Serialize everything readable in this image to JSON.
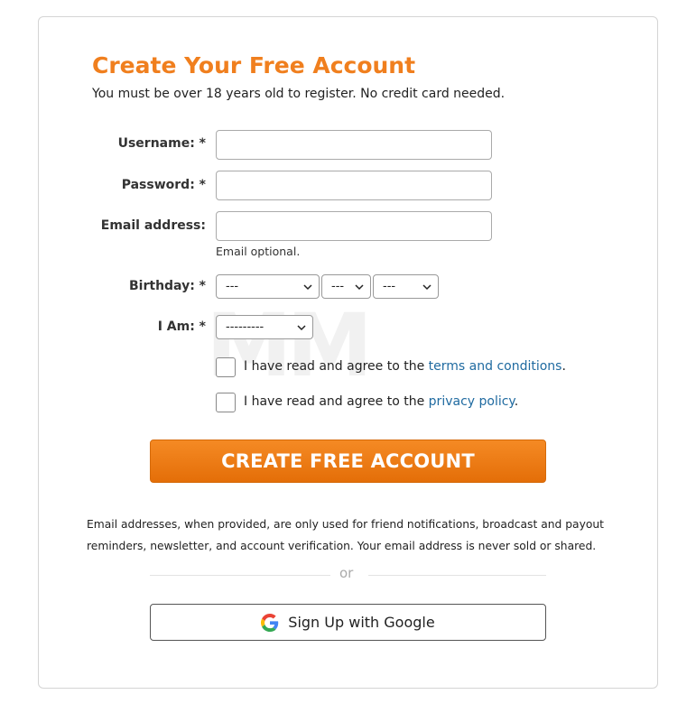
{
  "header": {
    "title": "Create Your Free Account",
    "subtitle": "You must be over 18 years old to register. No credit card needed."
  },
  "form": {
    "username_label": "Username: *",
    "password_label": "Password: *",
    "email_label": "Email address:",
    "email_hint": "Email optional.",
    "birthday_label": "Birthday: *",
    "birthday_month": "---",
    "birthday_day": "---",
    "birthday_year": "---",
    "gender_label": "I Am: *",
    "gender_value": "---------",
    "terms_prefix": "I have read and agree to the ",
    "terms_link": "terms and conditions",
    "terms_suffix": ".",
    "privacy_prefix": "I have read and agree to the ",
    "privacy_link": "privacy policy",
    "privacy_suffix": "."
  },
  "actions": {
    "create_label": "CREATE FREE ACCOUNT",
    "disclaimer": "Email addresses, when provided, are only used for friend notifications, broadcast and payout reminders, newsletter, and account verification. Your email address is never sold or shared.",
    "or_text": "or",
    "google_label": "Sign Up with Google"
  },
  "colors": {
    "accent": "#f07f1e",
    "link": "#1f6aa0",
    "button": "#e46e08"
  },
  "icons": {
    "select_arrow": "chevron-down-icon",
    "google": "google-logo-icon"
  }
}
